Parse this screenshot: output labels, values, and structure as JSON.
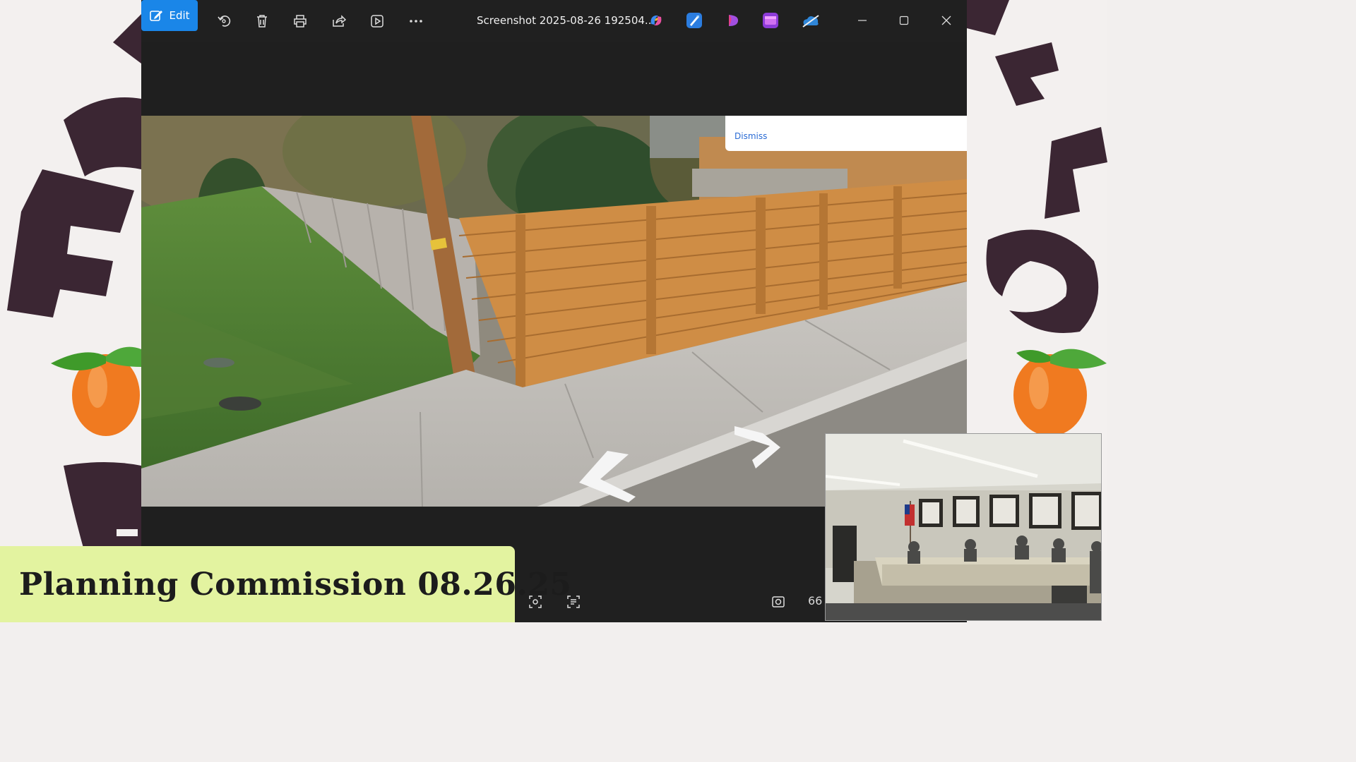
{
  "viewer": {
    "edit_label": "Edit",
    "file_title": "Screenshot 2025-08-26 192504....",
    "dismiss_label": "Dismiss",
    "zoom": "66"
  },
  "overlay": {
    "lower_third": "Planning Commission 08.26.25"
  },
  "colors": {
    "accent": "#1a86e8",
    "lower_third_bg": "#e3f3a0",
    "brand_plum": "#3b2633",
    "peach": "#f07a20"
  },
  "icons": {
    "toolbar": [
      "edit-icon",
      "rotate-icon",
      "delete-icon",
      "print-icon",
      "share-icon",
      "slideshow-icon",
      "more-icon"
    ],
    "apps": [
      "copilot-icon",
      "designer-icon",
      "clipchamp-icon",
      "video-editor-icon",
      "onedrive-icon"
    ],
    "bottom": [
      "crop-icon",
      "text-icon",
      "fit-icon"
    ]
  }
}
